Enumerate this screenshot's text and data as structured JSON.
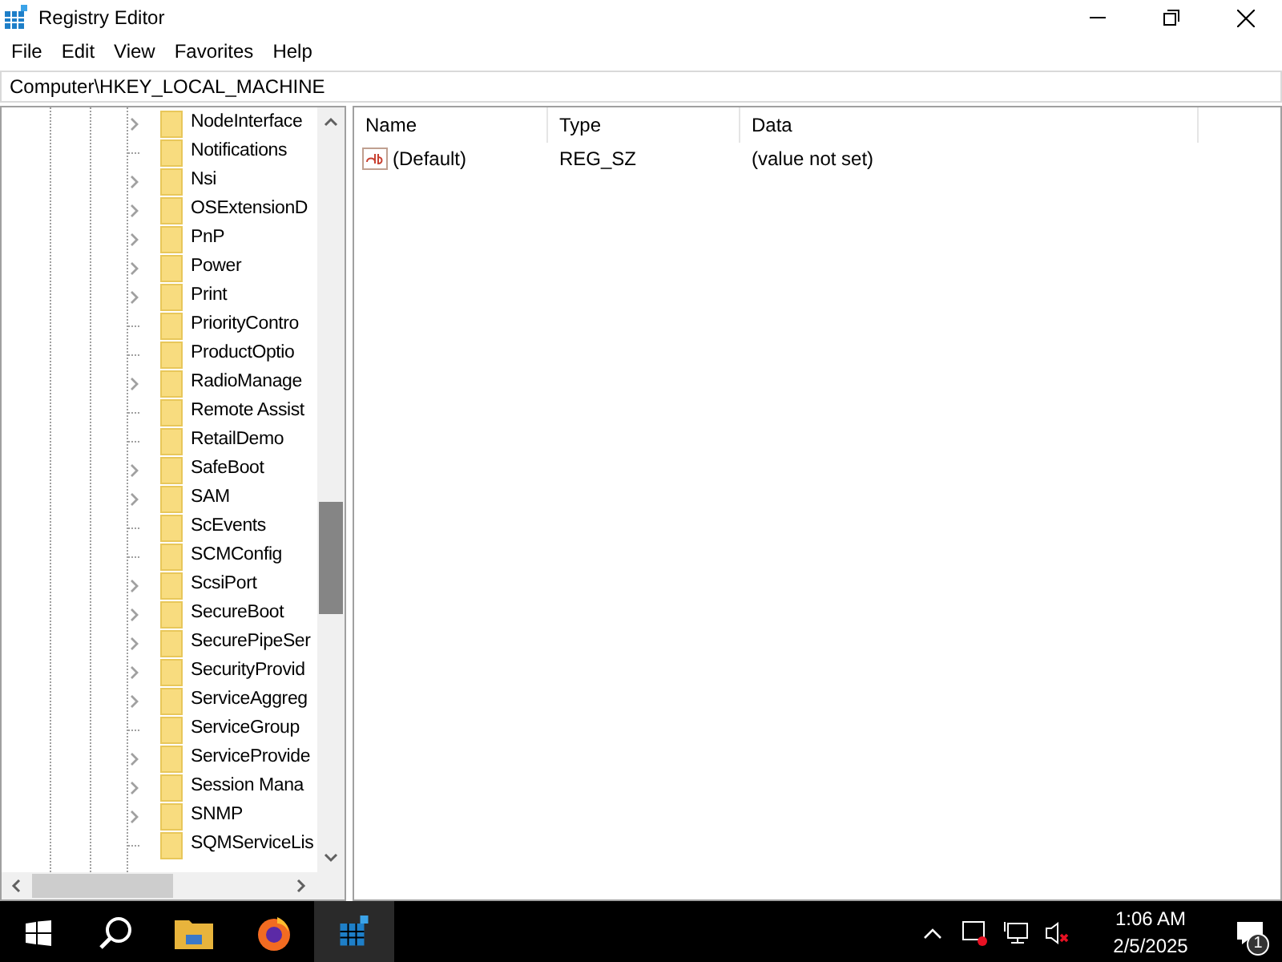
{
  "window": {
    "title": "Registry Editor"
  },
  "menu": [
    "File",
    "Edit",
    "View",
    "Favorites",
    "Help"
  ],
  "address": "Computer\\HKEY_LOCAL_MACHINE",
  "tree": [
    {
      "label": "NodeInterface",
      "expandable": true
    },
    {
      "label": "Notifications",
      "expandable": false
    },
    {
      "label": "Nsi",
      "expandable": true
    },
    {
      "label": "OSExtensionD",
      "expandable": true
    },
    {
      "label": "PnP",
      "expandable": true
    },
    {
      "label": "Power",
      "expandable": true
    },
    {
      "label": "Print",
      "expandable": true
    },
    {
      "label": "PriorityContro",
      "expandable": false
    },
    {
      "label": "ProductOptio",
      "expandable": false
    },
    {
      "label": "RadioManage",
      "expandable": true
    },
    {
      "label": "Remote Assist",
      "expandable": false
    },
    {
      "label": "RetailDemo",
      "expandable": false
    },
    {
      "label": "SafeBoot",
      "expandable": true
    },
    {
      "label": "SAM",
      "expandable": true
    },
    {
      "label": "ScEvents",
      "expandable": false
    },
    {
      "label": "SCMConfig",
      "expandable": false
    },
    {
      "label": "ScsiPort",
      "expandable": true
    },
    {
      "label": "SecureBoot",
      "expandable": true
    },
    {
      "label": "SecurePipeSer",
      "expandable": true
    },
    {
      "label": "SecurityProvid",
      "expandable": true
    },
    {
      "label": "ServiceAggreg",
      "expandable": true
    },
    {
      "label": "ServiceGroup",
      "expandable": false
    },
    {
      "label": "ServiceProvide",
      "expandable": true
    },
    {
      "label": "Session Mana",
      "expandable": true
    },
    {
      "label": "SNMP",
      "expandable": true
    },
    {
      "label": "SQMServiceLis",
      "expandable": false
    }
  ],
  "table": {
    "columns": [
      "Name",
      "Type",
      "Data"
    ],
    "rows": [
      {
        "name": "(Default)",
        "type": "REG_SZ",
        "data": "(value not set)"
      }
    ]
  },
  "taskbar": {
    "time": "1:06 AM",
    "date": "2/5/2025",
    "notification_count": "1"
  }
}
